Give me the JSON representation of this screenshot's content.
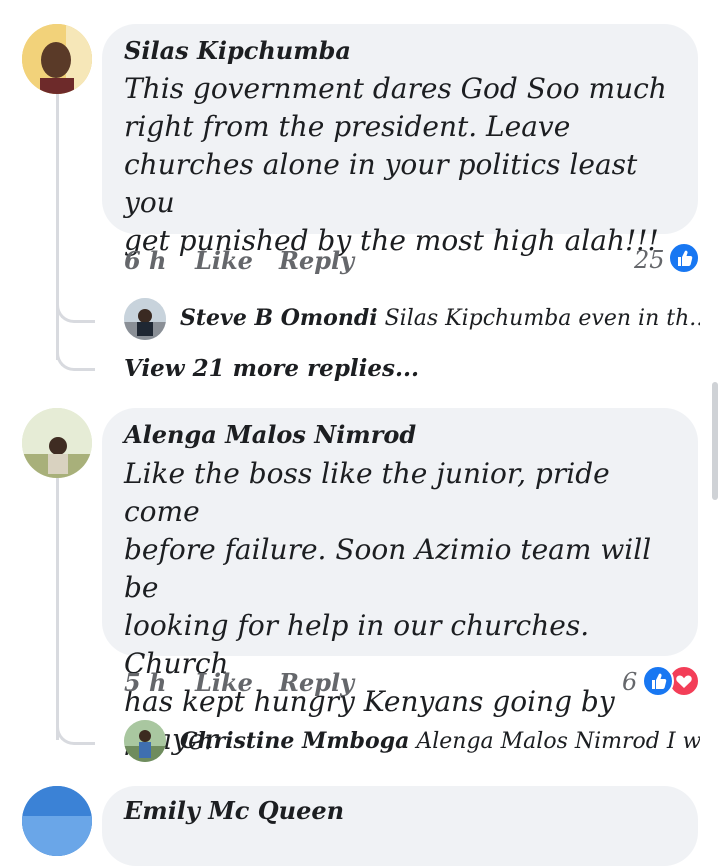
{
  "comments": [
    {
      "author": "Silas Kipchumba",
      "lines": [
        "This government dares God Soo much",
        "right from the president. Leave",
        "churches alone in your politics least you",
        "get punished by the most high alah!!!"
      ],
      "time": "6 h",
      "like_label": "Like",
      "reply_label": "Reply",
      "reaction_count": "25",
      "reactions": [
        "like"
      ],
      "reply": {
        "author": "Steve B Omondi",
        "text": "Silas Kipchumba  even in th..."
      },
      "view_more": "View 21 more replies..."
    },
    {
      "author": "Alenga Malos Nimrod",
      "lines": [
        "Like the boss like the junior, pride come",
        "before failure. Soon Azimio team will be",
        "looking for help in our churches. Church",
        "has kept hungry Kenyans going by",
        "prayer"
      ],
      "time": "5 h",
      "like_label": "Like",
      "reply_label": "Reply",
      "reaction_count": "6",
      "reactions": [
        "like",
        "love"
      ],
      "reply": {
        "author": "Christine Mmboga",
        "text": "Alenga Malos Nimrod I wi..."
      }
    },
    {
      "author": "Emily Mc Queen"
    }
  ],
  "colors": {
    "bubble": "#f0f2f5",
    "like_blue": "#1877f2",
    "love_red": "#f33e58",
    "muted": "#65676b"
  },
  "icons": {
    "like": "thumbs-up-icon",
    "love": "heart-icon"
  }
}
